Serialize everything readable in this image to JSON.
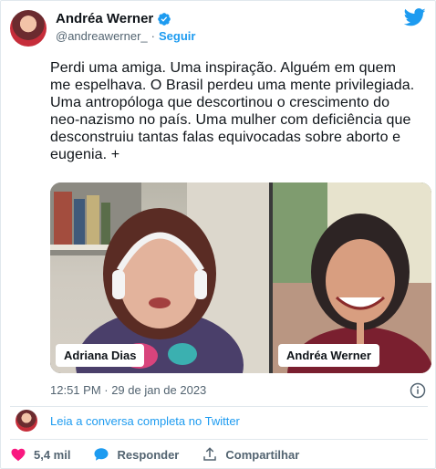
{
  "tweet": {
    "author_name": "Andréa Werner",
    "handle": "@andreawerner_",
    "separator": "·",
    "follow_label": "Seguir",
    "text": "Perdi uma amiga. Uma inspiração. Alguém em quem me espelhava. O Brasil perdeu uma mente privilegiada. Uma antropóloga que descortinou o crescimento do neo-nazismo no país. Uma mulher com deficiência que desconstruiu tantas falas equivocadas sobre aborto e eugenia. +",
    "timestamp": "12:51 PM · 29 de jan de 2023"
  },
  "media": {
    "left_name": "Adriana Dias",
    "right_name": "Andréa Werner"
  },
  "thread": {
    "read_conversation": "Leia a conversa completa no Twitter"
  },
  "actions": {
    "likes": "5,4 mil",
    "reply": "Responder",
    "share": "Compartilhar"
  },
  "colors": {
    "accent": "#1d9bf0",
    "like": "#f91880",
    "text": "#0f1419",
    "muted": "#536471"
  }
}
